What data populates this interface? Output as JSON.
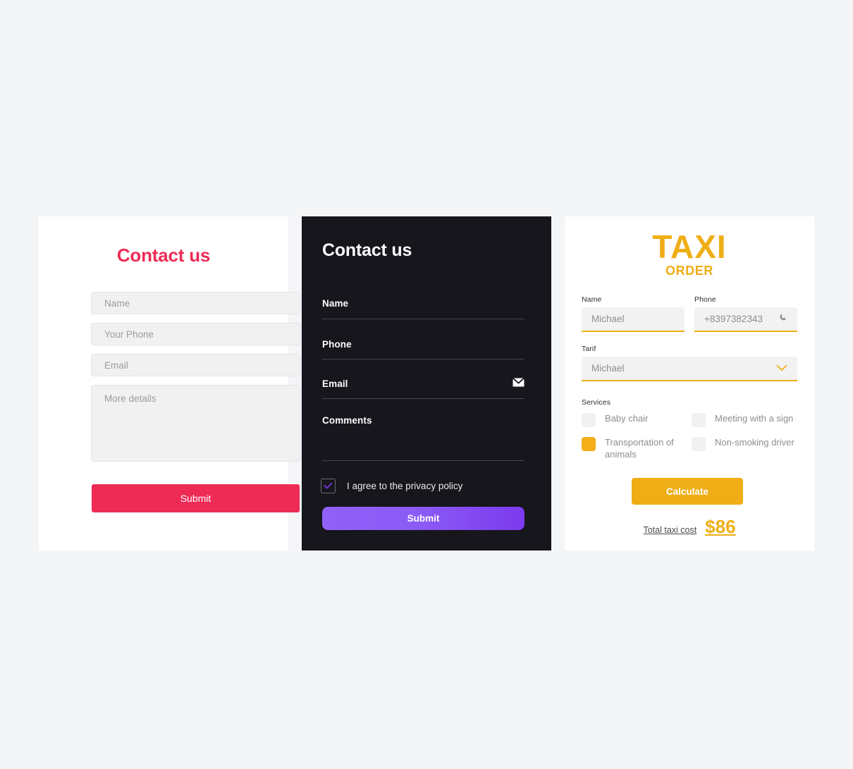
{
  "page": {
    "background_color": "#f4f5f7"
  },
  "contact_light": {
    "title": "Contact us",
    "accent_color": "#ee2b55",
    "fields": [
      {
        "name": "name",
        "placeholder": "Name",
        "value": ""
      },
      {
        "name": "phone",
        "placeholder": "Your Phone",
        "value": ""
      },
      {
        "name": "email",
        "placeholder": "Email",
        "value": ""
      }
    ],
    "textarea": {
      "name": "details",
      "placeholder": "More details",
      "value": ""
    },
    "submit_label": "Submit"
  },
  "contact_dark": {
    "title": "Contact us",
    "accent_color": "#8b5cf6",
    "background_color": "#16161c",
    "fields": [
      {
        "name": "name",
        "label": "Name",
        "value": "",
        "icon": ""
      },
      {
        "name": "phone",
        "label": "Phone",
        "value": "",
        "icon": ""
      },
      {
        "name": "email",
        "label": "Email",
        "value": "",
        "icon": "mail-icon"
      },
      {
        "name": "comments",
        "label": "Comments",
        "value": "",
        "icon": ""
      }
    ],
    "privacy": {
      "checked": true,
      "label": "I agree to the privacy policy"
    },
    "submit_label": "Submit"
  },
  "taxi_order": {
    "brand_main": "TAXI",
    "brand_sub": "ORDER",
    "accent_color": "#efae16",
    "name_label": "Name",
    "name_placeholder": "Michael",
    "phone_label": "Phone",
    "phone_placeholder": "+8397382343",
    "phone_icon": "phone-icon",
    "tarif_label": "Tarif",
    "tarif_value": "Michael",
    "tarif_icon": "chevron-down-icon",
    "services_label": "Services",
    "services": [
      {
        "label": "Baby chair",
        "checked": false
      },
      {
        "label": "Meeting with a sign",
        "checked": false
      },
      {
        "label": "Transportation of animals",
        "checked": true
      },
      {
        "label": "Non-smoking driver",
        "checked": false
      }
    ],
    "calculate_label": "Calculate",
    "total_label": "Total taxi cost",
    "total_value": "$86"
  }
}
